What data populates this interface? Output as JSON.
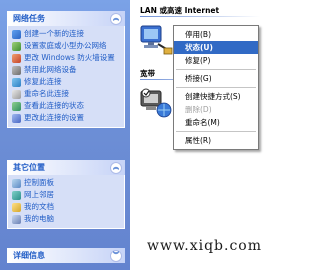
{
  "network_tasks": {
    "title": "网络任务",
    "items": [
      {
        "label": "创建一个新的连接",
        "icon": "new-connection-icon"
      },
      {
        "label": "设置家庭或小型办公网络",
        "icon": "home-network-icon"
      },
      {
        "label": "更改 Windows 防火墙设置",
        "icon": "firewall-icon"
      },
      {
        "label": "禁用此网络设备",
        "icon": "disable-device-icon"
      },
      {
        "label": "修复此连接",
        "icon": "repair-icon"
      },
      {
        "label": "重命名此连接",
        "icon": "rename-icon"
      },
      {
        "label": "查看此连接的状态",
        "icon": "status-icon"
      },
      {
        "label": "更改此连接的设置",
        "icon": "settings-icon"
      }
    ]
  },
  "other_places": {
    "title": "其它位置",
    "items": [
      {
        "label": "控制面板",
        "icon": "control-panel-icon"
      },
      {
        "label": "网上邻居",
        "icon": "network-places-icon"
      },
      {
        "label": "我的文档",
        "icon": "my-documents-icon"
      },
      {
        "label": "我的电脑",
        "icon": "my-computer-icon"
      }
    ]
  },
  "details": {
    "title": "详细信息"
  },
  "content": {
    "lan_section_title": "LAN 或高速 Internet",
    "broadband_section_title": "宽带"
  },
  "context_menu": {
    "items": [
      "停用(B)",
      "状态(U)",
      "修复(P)",
      "桥接(G)",
      "创建快捷方式(S)",
      "删除(D)",
      "重命名(M)",
      "属性(R)"
    ]
  },
  "watermark": "www.xiqb.com",
  "colors": {
    "pane_blue": "#6d8fd6",
    "link_blue": "#215dc6",
    "menu_highlight": "#316ac5"
  }
}
